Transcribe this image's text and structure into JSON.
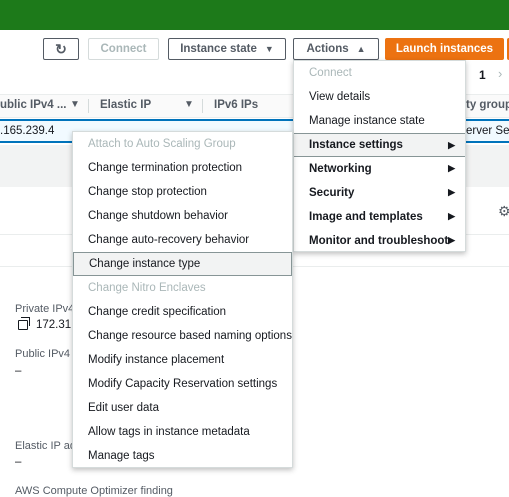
{
  "toolbar": {
    "refresh_icon": "refresh-icon",
    "connect_label": "Connect",
    "instance_state_label": "Instance state",
    "actions_label": "Actions",
    "launch_label": "Launch instances",
    "page_number": "1"
  },
  "table": {
    "headers": [
      "ublic IPv4 ...",
      "Elastic IP",
      "IPv6 IPs",
      "ty group"
    ],
    "row": {
      "public_ipv4": ".165.239.4",
      "security_group": "erver Sec"
    }
  },
  "details": {
    "private_ipv4_label": "Private IPv4",
    "private_ipv4_value": "172.31.",
    "public_ipv4_label": "Public IPv4",
    "public_ipv4_value": "–",
    "elastic_ip_label": "Elastic IP ad",
    "elastic_ip_value": "–",
    "optimizer_label": "AWS Compute Optimizer finding"
  },
  "actions_menu": {
    "items": [
      {
        "label": "Connect",
        "state": "disabled"
      },
      {
        "label": "View details",
        "state": "normal"
      },
      {
        "label": "Manage instance state",
        "state": "normal"
      },
      {
        "label": "Instance settings",
        "state": "active"
      },
      {
        "label": "Networking",
        "state": "bold"
      },
      {
        "label": "Security",
        "state": "bold"
      },
      {
        "label": "Image and templates",
        "state": "bold"
      },
      {
        "label": "Monitor and troubleshoot",
        "state": "bold"
      }
    ]
  },
  "instance_settings_menu": {
    "items": [
      {
        "label": "Attach to Auto Scaling Group",
        "state": "disabled"
      },
      {
        "label": "Change termination protection",
        "state": "normal"
      },
      {
        "label": "Change stop protection",
        "state": "normal"
      },
      {
        "label": "Change shutdown behavior",
        "state": "normal"
      },
      {
        "label": "Change auto-recovery behavior",
        "state": "normal"
      },
      {
        "label": "Change instance type",
        "state": "hover"
      },
      {
        "label": "Change Nitro Enclaves",
        "state": "disabled"
      },
      {
        "label": "Change credit specification",
        "state": "normal"
      },
      {
        "label": "Change resource based naming options",
        "state": "normal"
      },
      {
        "label": "Modify instance placement",
        "state": "normal"
      },
      {
        "label": "Modify Capacity Reservation settings",
        "state": "normal"
      },
      {
        "label": "Edit user data",
        "state": "normal"
      },
      {
        "label": "Allow tags in instance metadata",
        "state": "normal"
      },
      {
        "label": "Manage tags",
        "state": "normal"
      }
    ]
  },
  "colors": {
    "topbar": "#1d7a1a",
    "primary": "#ec7211",
    "selection": "#0073bb"
  }
}
